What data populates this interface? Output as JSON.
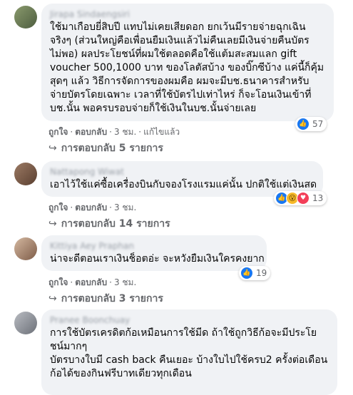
{
  "comments": [
    {
      "author": "Jirapa Sindaengsiri",
      "lines": [
        "ใช้มาเกือบยี่สิบปี แทบไม่เคยเสียดอก ยกเว้นมีรายจ่ายฉุกเฉิน",
        "จริงๆ (ส่วนใหญ่คือเพื่อนยืมเงินแล้วไม่คืนเลยมีเงินจ่ายคืนบัตร",
        "ไม่พอ) ผลประโยชน์ที่ผมใช้ตลอดคือใช้แต้มสะสมแลก gift",
        "voucher 500,1000 บาท ของโลตัสบ้าง ของบิ๊กซีบ้าง แค่นี้ก็คุ้ม",
        "สุดๆ แล้ว วิธีการจัดการของผมคือ ผมจะมีบช.ธนาคารสำหรับ",
        "จ่ายบัตรโดยเฉพาะ เวลาที่ใช้บัตรไปเท่าไหร่ ก็จะโอนเงินเข้าที่",
        "บช.นั้น พอครบรอบจ่ายก็ใช้เงินในบช.นั้นจ่ายเลย"
      ],
      "actions": {
        "like": "ถูกใจ",
        "reply": "ตอบกลับ",
        "time": "3 ชม.",
        "edited": "แก้ไขแล้ว"
      },
      "reaction_count": "57",
      "replies": "การตอบกลับ 5 รายการ"
    },
    {
      "author": "Nattapong Wiwat",
      "lines": [
        "เอาไว้ใช้แค่ซื้อเครื่องบินกับจองโรงแรมแค่นั้น ปกติใช้แต่เงินสด"
      ],
      "actions": {
        "like": "ถูกใจ",
        "reply": "ตอบกลับ",
        "time": "3 ชม."
      },
      "reaction_count": "13",
      "replies": "การตอบกลับ 14 รายการ"
    },
    {
      "author": "Kittiya Aey Praphan",
      "lines": [
        "น่าจะดีตอนเราเงินช็อตอ่ะ จะหวังยืมเงินใครคงยาก"
      ],
      "actions": {
        "like": "ถูกใจ",
        "reply": "ตอบกลับ",
        "time": "3 ชม."
      },
      "reaction_count": "19",
      "replies": "การตอบกลับ 3 รายการ"
    },
    {
      "author": "Pranee Boonchuay",
      "lines": [
        "การใช้บัตรเครดิตก้อเหมือนการใช้มีด ถ้าใช้ถูกวิธีก้อจะมีประโย",
        "ชน์มากๆ",
        "บัตรบางใบมี cash back คืนเยอะ บ้างใบไปใช้ครบ2 ครั้งต่อเดือน",
        "ก้อได้ของกินฟรีบาทเดียวทุกเดือน"
      ]
    }
  ],
  "colors": {
    "like": "#1877f2",
    "haha": "#f7b928",
    "love": "#f33e58",
    "bubble": "#f0f2f5"
  }
}
